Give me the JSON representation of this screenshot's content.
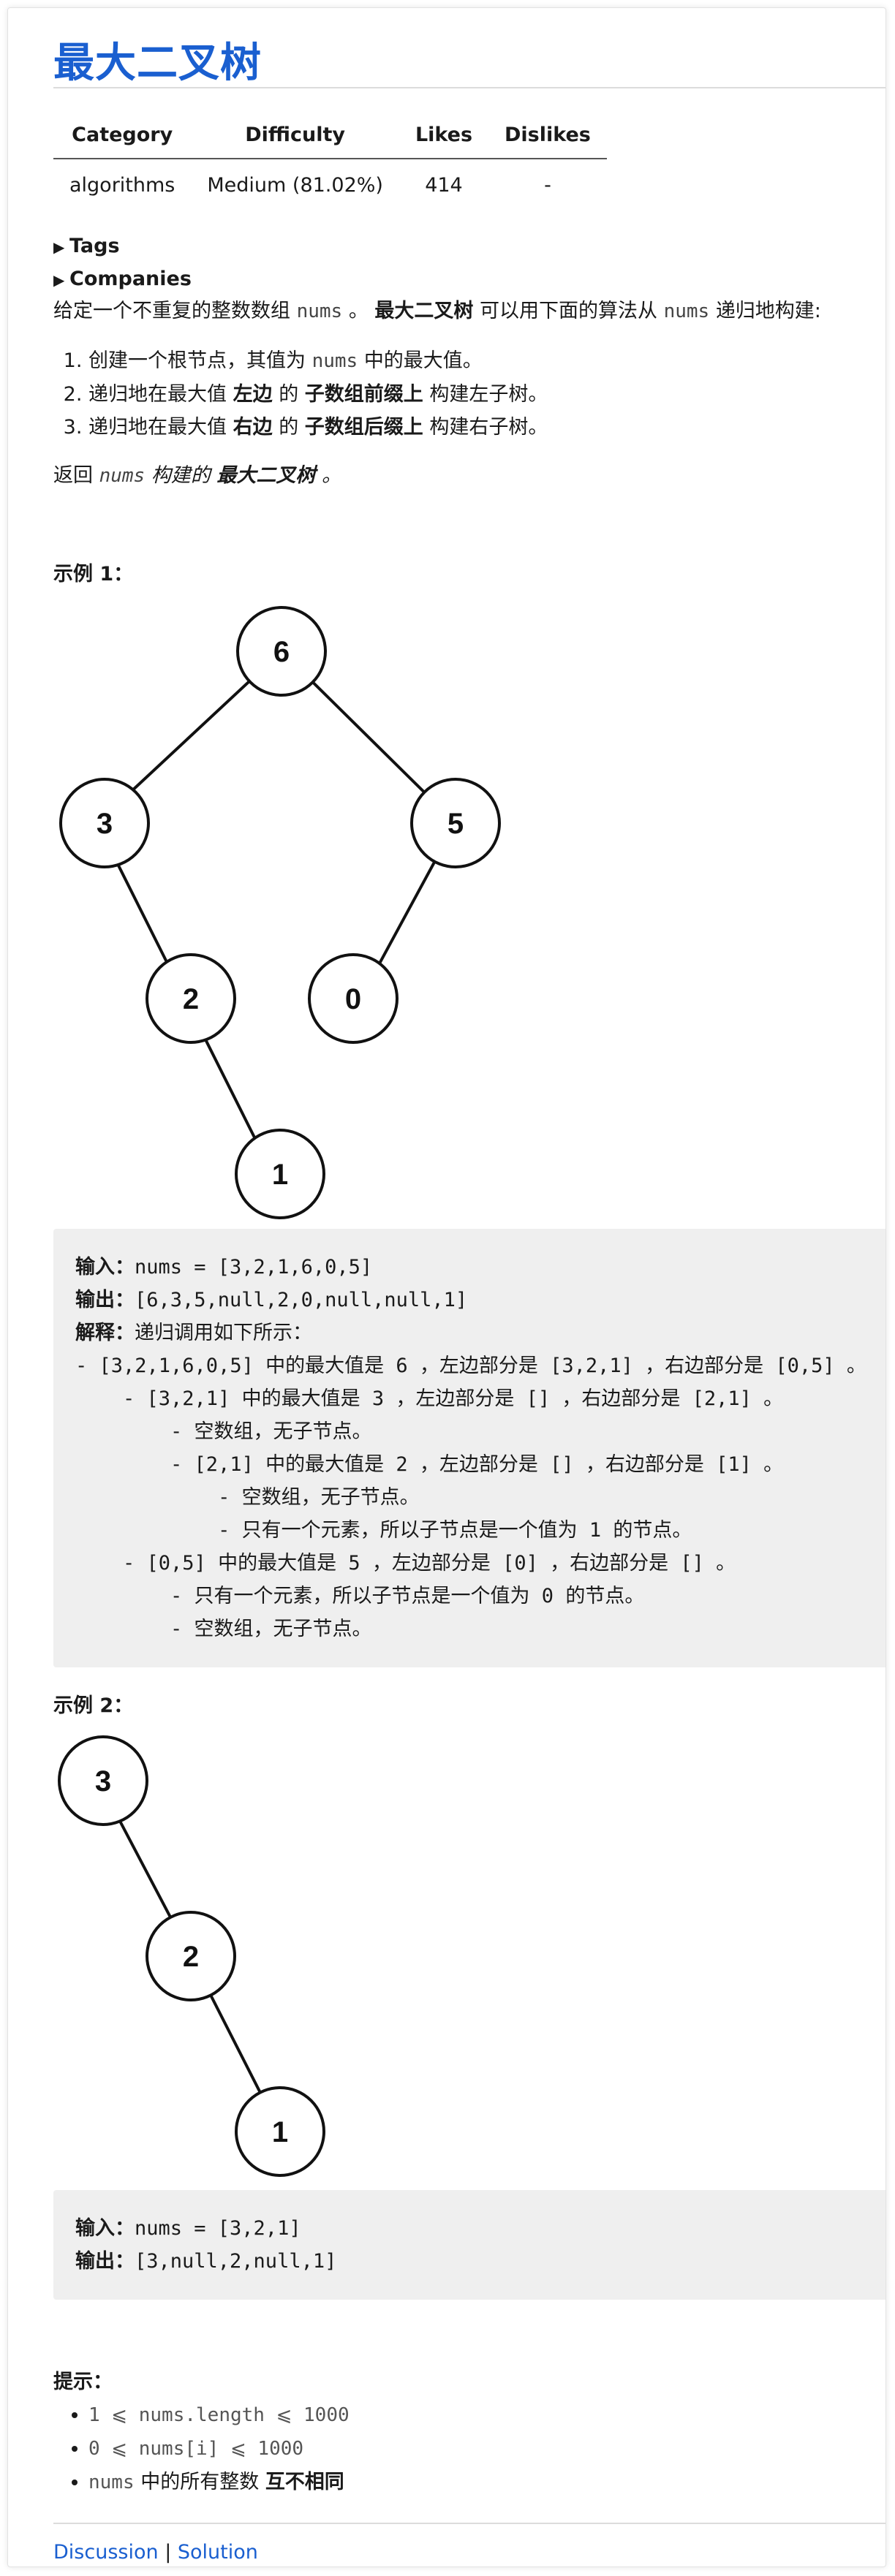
{
  "title": "最大二叉树",
  "meta_table": {
    "headers": [
      "Category",
      "Difficulty",
      "Likes",
      "Dislikes"
    ],
    "row": [
      "algorithms",
      "Medium (81.02%)",
      "414",
      "-"
    ]
  },
  "tags_label": "Tags",
  "companies_label": "Companies",
  "intro": {
    "p1": "给定一个不重复的整数数组",
    "nums": "nums",
    "p2": "。",
    "bold": "最大二叉树",
    "p3": "可以用下面的算法从",
    "nums2": "nums",
    "p4": "递归地构建:"
  },
  "steps": [
    {
      "a": "创建一个根节点，其值为",
      "code": "nums",
      "b": "中的最大值。"
    },
    {
      "a": "递归地在最大值",
      "b1": "左边",
      "m": "的",
      "b2": "子数组前缀上",
      "c": "构建左子树。"
    },
    {
      "a": "递归地在最大值",
      "b1": "右边",
      "m": "的",
      "b2": "子数组后缀上",
      "c": "构建右子树。"
    }
  ],
  "return_text": {
    "a": "返回",
    "code": "nums",
    "b": "构建的",
    "bold": "最大二叉树",
    "c": "。"
  },
  "example1": {
    "heading": "示例 1：",
    "tree_nodes": [
      "6",
      "3",
      "5",
      "2",
      "0",
      "1"
    ],
    "lines": [
      {
        "label": "输入：",
        "text": "nums = [3,2,1,6,0,5]"
      },
      {
        "label": "输出：",
        "text": "[6,3,5,null,2,0,null,null,1]"
      },
      {
        "label": "解释：",
        "text": "递归调用如下所示："
      },
      {
        "label": "",
        "text": "- [3,2,1,6,0,5] 中的最大值是 6 ，左边部分是 [3,2,1] ，右边部分是 [0,5] 。"
      },
      {
        "label": "",
        "text": "    - [3,2,1] 中的最大值是 3 ，左边部分是 [] ，右边部分是 [2,1] 。"
      },
      {
        "label": "",
        "text": "        - 空数组，无子节点。"
      },
      {
        "label": "",
        "text": "        - [2,1] 中的最大值是 2 ，左边部分是 [] ，右边部分是 [1] 。"
      },
      {
        "label": "",
        "text": "            - 空数组，无子节点。"
      },
      {
        "label": "",
        "text": "            - 只有一个元素，所以子节点是一个值为 1 的节点。"
      },
      {
        "label": "",
        "text": "    - [0,5] 中的最大值是 5 ，左边部分是 [0] ，右边部分是 [] 。"
      },
      {
        "label": "",
        "text": "        - 只有一个元素，所以子节点是一个值为 0 的节点。"
      },
      {
        "label": "",
        "text": "        - 空数组，无子节点。"
      }
    ]
  },
  "example2": {
    "heading": "示例 2：",
    "tree_nodes": [
      "3",
      "2",
      "1"
    ],
    "lines": [
      {
        "label": "输入：",
        "text": "nums = [3,2,1]"
      },
      {
        "label": "输出：",
        "text": "[3,null,2,null,1]"
      }
    ]
  },
  "hints": {
    "heading": "提示：",
    "items": [
      {
        "code": "1 <= nums.length <= 1000",
        "text": ""
      },
      {
        "code": "0 <= nums[i] <= 1000",
        "text": ""
      },
      {
        "code": "nums",
        "text": "中的所有整数",
        "bold": "互不相同"
      }
    ]
  },
  "footer": {
    "discussion": "Discussion",
    "sep": "|",
    "solution": "Solution"
  }
}
